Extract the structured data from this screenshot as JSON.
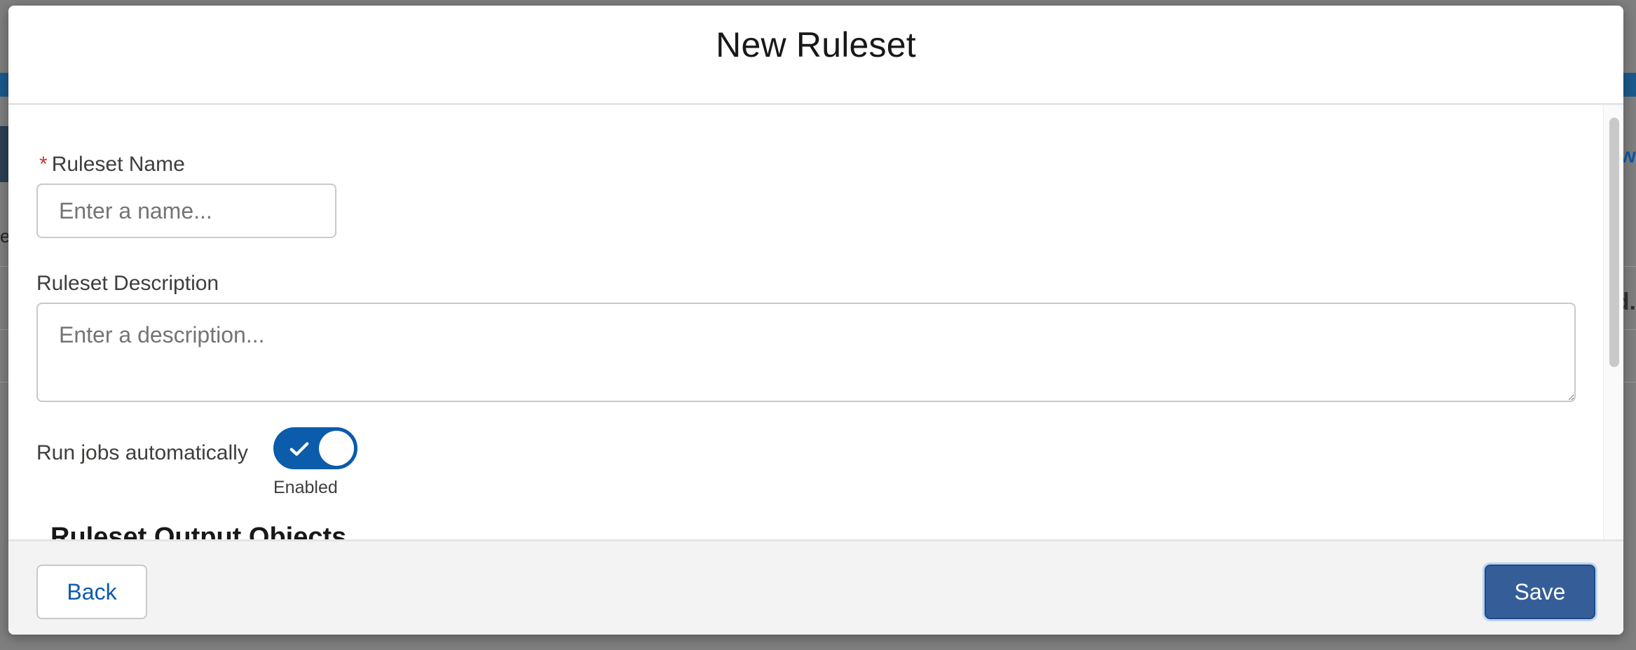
{
  "background": {
    "left_text": "e",
    "right_text_top": "w",
    "right_text_bottom": "d."
  },
  "modal": {
    "title": "New Ruleset"
  },
  "form": {
    "name": {
      "label": "Ruleset Name",
      "required_mark": "*",
      "placeholder": "Enter a name...",
      "value": ""
    },
    "description": {
      "label": "Ruleset Description",
      "placeholder": "Enter a description...",
      "value": ""
    },
    "auto_run": {
      "label": "Run jobs automatically",
      "status": "Enabled",
      "checked": true
    },
    "section_heading": "Ruleset Output Objects"
  },
  "footer": {
    "back_label": "Back",
    "save_label": "Save"
  },
  "colors": {
    "brand_blue": "#0b5cab",
    "save_button": "#355e99",
    "required": "#c23934"
  },
  "icons": {
    "toggle_check": "check-icon"
  }
}
